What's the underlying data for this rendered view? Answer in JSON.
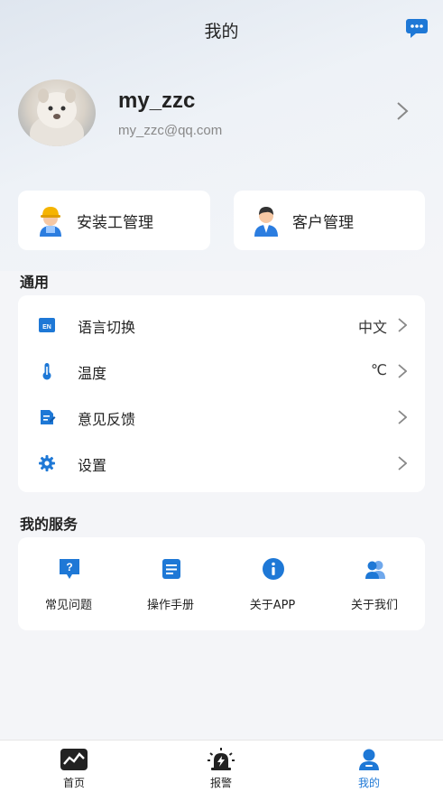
{
  "header": {
    "title": "我的"
  },
  "profile": {
    "username": "my_zzc",
    "email": "my_zzc@qq.com"
  },
  "management": [
    {
      "label": "安装工管理",
      "icon": "installer-worker-icon"
    },
    {
      "label": "客户管理",
      "icon": "customer-person-icon"
    }
  ],
  "general": {
    "title": "通用",
    "items": [
      {
        "label": "语言切换",
        "value": "中文",
        "icon": "language-en-icon"
      },
      {
        "label": "温度",
        "value": "℃",
        "icon": "thermometer-icon"
      },
      {
        "label": "意见反馈",
        "value": "",
        "icon": "feedback-edit-icon"
      },
      {
        "label": "设置",
        "value": "",
        "icon": "gear-icon"
      }
    ]
  },
  "services": {
    "title": "我的服务",
    "items": [
      {
        "label": "常见问题",
        "icon": "question-icon"
      },
      {
        "label": "操作手册",
        "icon": "manual-icon"
      },
      {
        "label": "关于APP",
        "icon": "info-icon"
      },
      {
        "label": "关于我们",
        "icon": "users-icon"
      }
    ]
  },
  "tabbar": {
    "items": [
      {
        "label": "首页",
        "icon": "home-chart-icon",
        "active": false
      },
      {
        "label": "报警",
        "icon": "alarm-siren-icon",
        "active": false
      },
      {
        "label": "我的",
        "icon": "user-icon",
        "active": true
      }
    ]
  },
  "colors": {
    "accent": "#1e78d6",
    "background": "#f4f5f8",
    "card": "#ffffff"
  }
}
